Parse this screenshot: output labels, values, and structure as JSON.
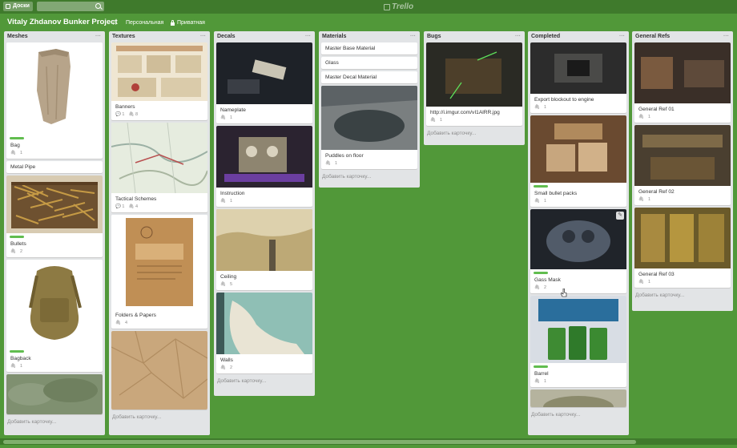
{
  "header": {
    "boards_label": "Доски",
    "logo_text": "Trello"
  },
  "board": {
    "title": "Vitaly Zhdanov Bunker Project",
    "team": "Персональная",
    "visibility": "Приватная"
  },
  "add_card_label": "Добавить карточку...",
  "lists": {
    "meshes": {
      "title": "Meshes",
      "cards": [
        "Bag",
        "Metal Pipe",
        "Bullets",
        "Bagback"
      ],
      "counts": [
        "1",
        "2",
        "1"
      ]
    },
    "textures": {
      "title": "Textures",
      "cards": [
        "Banners",
        "Tactical Schemes",
        "Folders & Papers"
      ],
      "counts": [
        "1",
        "8",
        "1",
        "4",
        "4"
      ]
    },
    "decals": {
      "title": "Decals",
      "cards": [
        "Nameplate",
        "Instruction",
        "Ceiling",
        "Walls"
      ],
      "counts": [
        "1",
        "1",
        "5",
        "2"
      ]
    },
    "materials": {
      "title": "Materials",
      "cards": [
        "Master Base Material",
        "Glass",
        "Master Decal Material",
        "Puddles on floor"
      ],
      "counts": [
        "1"
      ]
    },
    "bugs": {
      "title": "Bugs",
      "cards": [
        "http://i.imgur.com/vI1AlRR.jpg"
      ],
      "counts": [
        "1"
      ]
    },
    "completed": {
      "title": "Completed",
      "cards": [
        "Export blockout to engine",
        "Small bullet packs",
        "Gass Mask",
        "Barrel"
      ],
      "counts": [
        "1",
        "1",
        "2",
        "1"
      ]
    },
    "refs": {
      "title": "General Refs",
      "cards": [
        "General Ref 01",
        "General Ref 02",
        "General Ref 03"
      ],
      "counts": [
        "1",
        "1",
        "1"
      ]
    }
  },
  "colors": {
    "board_bg": "#519839",
    "header_bg": "#3f7a2c",
    "label_green": "#61bd4f",
    "list_bg": "#e2e4e6"
  }
}
